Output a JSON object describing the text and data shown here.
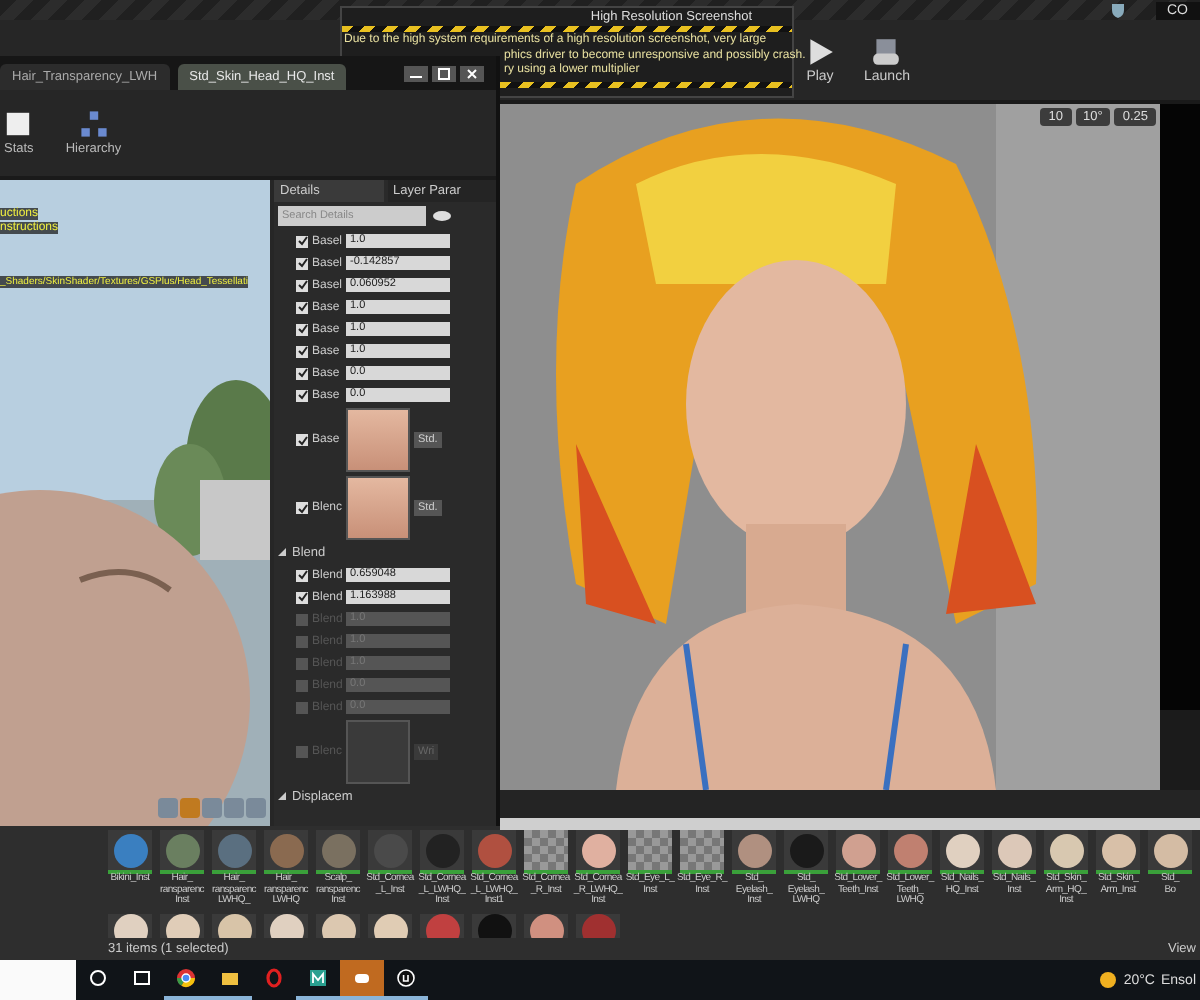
{
  "screenshot_dialog": {
    "title": "High Resolution Screenshot",
    "lines": [
      "Due to the high system requirements of a high resolution screenshot, very large",
      "phics driver to become unresponsive and possibly crash.",
      "ry using a lower multiplier"
    ]
  },
  "top_bar": {
    "badge": "CO"
  },
  "toolbar": {
    "buttons": [
      {
        "kind": "play",
        "label": "Play"
      },
      {
        "kind": "launch",
        "label": "Launch"
      }
    ]
  },
  "viewport": {
    "kind": "picture",
    "controls": [
      "10",
      "10°",
      "0.25"
    ]
  },
  "material_editor": {
    "tabs": [
      {
        "label": "Hair_Transparency_LWH",
        "selected": false
      },
      {
        "label": "Std_Skin_Head_HQ_Inst",
        "selected": true
      }
    ],
    "toolbar": [
      "Stats",
      "Hierarchy"
    ],
    "viewport_messages": [
      "uctions",
      "nstructions",
      "_Shaders/SkinShader/Textures/GSPlus/Head_Tessellati"
    ],
    "panel_tabs": [
      {
        "label": "Details",
        "selected": true
      },
      {
        "label": "Layer Parar",
        "selected": false
      }
    ],
    "search": {
      "placeholder": "Search Details"
    },
    "rows": [
      {
        "kind": "scalar",
        "label": "Basel",
        "value": "1.0",
        "checked": true
      },
      {
        "kind": "scalar",
        "label": "Basel",
        "value": "-0.142857",
        "checked": true
      },
      {
        "kind": "scalar",
        "label": "Basel",
        "value": "0.060952",
        "checked": true
      },
      {
        "kind": "scalar",
        "label": "Base",
        "value": "1.0",
        "checked": true
      },
      {
        "kind": "scalar",
        "label": "Base",
        "value": "1.0",
        "checked": true
      },
      {
        "kind": "scalar",
        "label": "Base",
        "value": "1.0",
        "checked": true
      },
      {
        "kind": "scalar",
        "label": "Base",
        "value": "0.0",
        "checked": true
      },
      {
        "kind": "scalar",
        "label": "Base",
        "value": "0.0",
        "checked": true
      },
      {
        "kind": "texture",
        "label": "Base",
        "asset": "Std.",
        "checked": true
      },
      {
        "kind": "texture",
        "label": "Blenc",
        "asset": "Std.",
        "checked": true
      },
      {
        "kind": "section",
        "label": "Blend"
      },
      {
        "kind": "scalar",
        "label": "Blend",
        "value": "0.659048",
        "checked": true
      },
      {
        "kind": "scalar",
        "label": "Blend",
        "value": "1.163988",
        "checked": true
      },
      {
        "kind": "scalar",
        "label": "Blend",
        "value": "1.0",
        "checked": false
      },
      {
        "kind": "scalar",
        "label": "Blend",
        "value": "1.0",
        "checked": false
      },
      {
        "kind": "scalar",
        "label": "Blend",
        "value": "1.0",
        "checked": false
      },
      {
        "kind": "scalar",
        "label": "Blend",
        "value": "0.0",
        "checked": false
      },
      {
        "kind": "scalar",
        "label": "Blend",
        "value": "0.0",
        "checked": false
      },
      {
        "kind": "texture",
        "label": "Blenc",
        "asset": "Wri",
        "checked": false
      },
      {
        "kind": "section",
        "label": "Displacem"
      }
    ]
  },
  "content_browser": {
    "assets": [
      {
        "name": "Bikini_Inst",
        "kind": "sphere",
        "color": "#3a7fc0"
      },
      {
        "name": "Hair_\nransparenc\nInst",
        "kind": "sphere",
        "color": "#6a7f60"
      },
      {
        "name": "Hair_\nransparenc\nLWHQ_",
        "kind": "sphere",
        "color": "#5a6f80"
      },
      {
        "name": "Hair_\nransparenc\nLWHQ",
        "kind": "sphere",
        "color": "#8a6a50"
      },
      {
        "name": "Scalp_\nransparenc\nInst",
        "kind": "sphere",
        "color": "#7a7060"
      },
      {
        "name": "Std_Cornea\n_L_Inst",
        "kind": "sphere",
        "color": "#4a4a4a"
      },
      {
        "name": "Std_Cornea\n_L_LWHQ_\nInst",
        "kind": "sphere",
        "color": "#222222"
      },
      {
        "name": "Std_Cornea\n_L_LWHQ_\nInst1",
        "kind": "sphere",
        "color": "#b05040"
      },
      {
        "name": "Std_Cornea\n_R_Inst",
        "kind": "checker"
      },
      {
        "name": "Std_Cornea\n_R_LWHQ_\nInst",
        "kind": "sphere",
        "color": "#e0b0a0"
      },
      {
        "name": "Std_Eye_L_\nInst",
        "kind": "checker"
      },
      {
        "name": "Std_Eye_R_\nInst",
        "kind": "checker"
      },
      {
        "name": "Std_\nEyelash_\nInst",
        "kind": "sphere",
        "color": "#b09080"
      },
      {
        "name": "Std_\nEyelash_\nLWHQ",
        "kind": "sphere",
        "color": "#1a1a1a"
      },
      {
        "name": "Std_Lower_\nTeeth_Inst",
        "kind": "sphere",
        "color": "#d0a090"
      },
      {
        "name": "Std_Lower_\nTeeth_\nLWHQ",
        "kind": "sphere",
        "color": "#c08070"
      },
      {
        "name": "Std_Nails_\nHQ_Inst",
        "kind": "sphere",
        "color": "#e0d0c0"
      },
      {
        "name": "Std_Nails_\nInst",
        "kind": "sphere",
        "color": "#dcc8b8"
      },
      {
        "name": "Std_Skin_\nArm_HQ_\nInst",
        "kind": "sphere",
        "color": "#d8c8b0"
      },
      {
        "name": "Std_Skin_\nArm_Inst",
        "kind": "sphere",
        "color": "#d8c0a8"
      },
      {
        "name": "Std_\nBo",
        "kind": "sphere",
        "color": "#d4bca4"
      }
    ],
    "more_assets": [
      {
        "kind": "sphere",
        "color": "#e0d0c0"
      },
      {
        "kind": "sphere",
        "color": "#e0cdb8"
      },
      {
        "kind": "sphere",
        "color": "#d8c4a8"
      },
      {
        "kind": "sphere",
        "color": "#e0d0c0"
      },
      {
        "kind": "sphere",
        "color": "#dcc8b0"
      },
      {
        "kind": "sphere",
        "color": "#e0ccb4"
      },
      {
        "kind": "sphere",
        "color": "#c04040"
      },
      {
        "kind": "sphere",
        "color": "#111111"
      },
      {
        "kind": "sphere",
        "color": "#d09080"
      },
      {
        "kind": "sphere",
        "color": "#a03030"
      }
    ],
    "status": "31 items (1 selected)",
    "view": "View"
  },
  "taskbar": {
    "apps": [
      {
        "kind": "search",
        "running": false,
        "selected": false
      },
      {
        "kind": "taskview",
        "running": false,
        "selected": false
      },
      {
        "kind": "chrome",
        "running": true,
        "selected": false
      },
      {
        "kind": "files",
        "running": true,
        "selected": false
      },
      {
        "kind": "opera",
        "running": false,
        "selected": false
      },
      {
        "kind": "m",
        "running": true,
        "selected": false
      },
      {
        "kind": "discord",
        "running": true,
        "selected": true
      },
      {
        "kind": "unreal",
        "running": true,
        "selected": false
      }
    ],
    "temperature": "20°C",
    "weather": "Ensol"
  }
}
